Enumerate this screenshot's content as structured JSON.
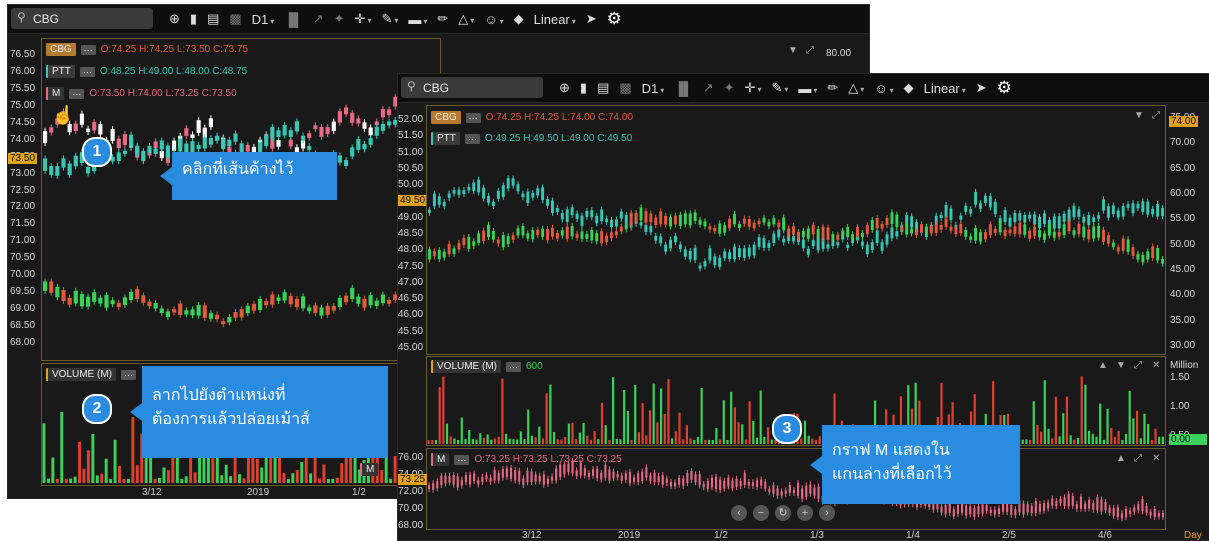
{
  "colors": {
    "accent": "#2a8ce0",
    "cbg": "#e05a3c",
    "ptt": "#39c7b4",
    "m_series": "#e56a86",
    "price_tag": "#e0a11c",
    "volume_up": "#3ad25a",
    "volume_down": "#e0402e"
  },
  "icons": [
    "search-icon",
    "add-icon",
    "new-chart-icon",
    "compare-icon",
    "area-chart-icon",
    "bar-type-icon",
    "line-type-icon",
    "candle-type-icon",
    "crosshair-icon",
    "pen-icon",
    "ruler-icon",
    "shapes-icon",
    "emoji-icon",
    "tag-icon",
    "share-icon",
    "gear-icon"
  ],
  "winA": {
    "search": {
      "value": "CBG"
    },
    "toolbar": {
      "interval": "D1",
      "scale": "Linear"
    },
    "legend": {
      "cbg": {
        "tag": "CBG",
        "ohlc": "O:74.25 H:74.25 L:73.50 C:73.75"
      },
      "ptt": {
        "tag": "PTT",
        "ohlc": "O:48.25 H:49.00 L:48.00 C:48.75"
      },
      "m": {
        "tag": "M",
        "ohlc": "O:73.50 H:74.00 L:73.25 C:73.50"
      }
    },
    "right_value": "80.00",
    "yaxis": [
      "76.50",
      "76.00",
      "75.50",
      "75.00",
      "74.50",
      "74.00",
      "73.50",
      "73.00",
      "72.50",
      "72.00",
      "71.50",
      "71.00",
      "70.50",
      "70.00",
      "69.50",
      "69.00",
      "68.50",
      "68.00"
    ],
    "price_tag": "73.50",
    "volume": {
      "tag": "VOLUME (M)"
    },
    "m_badge": "M",
    "xaxis": [
      "3/12",
      "2019",
      "1/2"
    ]
  },
  "winB": {
    "search": {
      "value": "CBG"
    },
    "toolbar": {
      "interval": "D1",
      "scale": "Linear"
    },
    "legend": {
      "cbg": {
        "tag": "CBG",
        "ohlc": "O:74.25 H:74.25 L:74.00 C:74.00"
      },
      "ptt": {
        "tag": "PTT",
        "ohlc": "O:49.25 H:49.50 L:49.00 C:49.50"
      }
    },
    "yaxis_left": [
      "52.00",
      "51.50",
      "51.00",
      "50.50",
      "50.00",
      "49.50",
      "49.00",
      "48.50",
      "48.00",
      "47.50",
      "47.00",
      "46.50",
      "46.00",
      "45.50",
      "45.00"
    ],
    "left_tag": "49.50",
    "yaxis_right": [
      "75.00",
      "70.00",
      "65.00",
      "60.00",
      "55.00",
      "50.00",
      "45.00",
      "40.00",
      "35.00",
      "30.00"
    ],
    "right_tag": "74.00",
    "volume": {
      "tag": "VOLUME (M)",
      "value": "600",
      "units": "Million",
      "yaxis": [
        "1.50",
        "1.00",
        "0.50"
      ],
      "tag_value": "0.00"
    },
    "m": {
      "tag": "M",
      "ohlc": "O:73.25 H:73.25 L:73.25 C:73.25",
      "yaxis": [
        "76.00",
        "74.00",
        "72.00",
        "70.00",
        "68.00"
      ],
      "price_tag": "73.25"
    },
    "xaxis": [
      "3/12",
      "2019",
      "1/2",
      "1/3",
      "1/4",
      "2/5",
      "4/6"
    ],
    "x_unit": "Day"
  },
  "callouts": [
    {
      "num": "1",
      "text": "คลิกที่เส้นค้างไว้"
    },
    {
      "num": "2",
      "line1": "ลากไปยังตำแหน่งที่",
      "line2": "ต้องการแล้วปล่อยเม้าส์"
    },
    {
      "num": "3",
      "line1": "กราฟ M แสดงใน",
      "line2": "แกนล่างที่เลือกไว้"
    }
  ]
}
